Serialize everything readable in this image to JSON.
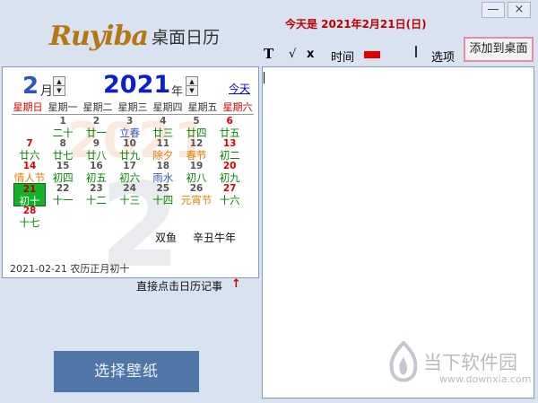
{
  "app": {
    "logo_brand": "Ruyiba",
    "logo_title": "桌面日历",
    "today_header": "今天是 2021年2月21日(日)",
    "min_icon": "minimize-icon",
    "close_icon": "close-icon",
    "min_glyph": "—",
    "close_glyph": "×"
  },
  "toolbar": {
    "bold_label": "T",
    "check_label": "√",
    "x_label": "x",
    "time_label": "时间",
    "color_swatch": "#e00000",
    "options_label": "选项",
    "add_to_desktop_label": "添加到桌面"
  },
  "calendar": {
    "month": "2",
    "month_unit": "月",
    "year": "2021",
    "year_unit": "年",
    "today_link": "今天",
    "watermark_year": "2021",
    "watermark_month": "2",
    "spin_up": "▲",
    "spin_down": "▼",
    "weekdays": [
      "星期日",
      "星期一",
      "星期二",
      "星期三",
      "星期四",
      "星期五",
      "星期六"
    ],
    "days": [
      {
        "d": "1",
        "l": "二十",
        "col": 1,
        "row": 0
      },
      {
        "d": "2",
        "l": "廿一",
        "col": 2,
        "row": 0
      },
      {
        "d": "3",
        "l": "立春",
        "col": 3,
        "row": 0,
        "type": "term"
      },
      {
        "d": "4",
        "l": "廿三",
        "col": 4,
        "row": 0
      },
      {
        "d": "5",
        "l": "廿四",
        "col": 5,
        "row": 0
      },
      {
        "d": "6",
        "l": "廿五",
        "col": 6,
        "row": 0
      },
      {
        "d": "7",
        "l": "廿六",
        "col": 0,
        "row": 1
      },
      {
        "d": "8",
        "l": "廿七",
        "col": 1,
        "row": 1
      },
      {
        "d": "9",
        "l": "廿八",
        "col": 2,
        "row": 1
      },
      {
        "d": "10",
        "l": "廿九",
        "col": 3,
        "row": 1
      },
      {
        "d": "11",
        "l": "除夕",
        "col": 4,
        "row": 1,
        "type": "fest"
      },
      {
        "d": "12",
        "l": "春节",
        "col": 5,
        "row": 1,
        "type": "fest"
      },
      {
        "d": "13",
        "l": "初二",
        "col": 6,
        "row": 1
      },
      {
        "d": "14",
        "l": "情人节",
        "col": 0,
        "row": 2,
        "type": "fest"
      },
      {
        "d": "15",
        "l": "初四",
        "col": 1,
        "row": 2
      },
      {
        "d": "16",
        "l": "初五",
        "col": 2,
        "row": 2
      },
      {
        "d": "17",
        "l": "初六",
        "col": 3,
        "row": 2
      },
      {
        "d": "18",
        "l": "雨水",
        "col": 4,
        "row": 2,
        "type": "term"
      },
      {
        "d": "19",
        "l": "初八",
        "col": 5,
        "row": 2
      },
      {
        "d": "20",
        "l": "初九",
        "col": 6,
        "row": 2
      },
      {
        "d": "21",
        "l": "初十",
        "col": 0,
        "row": 3,
        "type": "sel"
      },
      {
        "d": "22",
        "l": "十一",
        "col": 1,
        "row": 3
      },
      {
        "d": "23",
        "l": "十二",
        "col": 2,
        "row": 3
      },
      {
        "d": "24",
        "l": "十三",
        "col": 3,
        "row": 3
      },
      {
        "d": "25",
        "l": "十四",
        "col": 4,
        "row": 3
      },
      {
        "d": "26",
        "l": "元宵节",
        "col": 5,
        "row": 3,
        "type": "fest"
      },
      {
        "d": "27",
        "l": "十六",
        "col": 6,
        "row": 3
      },
      {
        "d": "28",
        "l": "十七",
        "col": 0,
        "row": 4
      }
    ],
    "zodiac": "双鱼",
    "ganzhi": "辛丑牛年",
    "status": "2021-02-21 农历正月初十"
  },
  "hint": {
    "text": "直接点击日历记事",
    "arrow": "↑"
  },
  "wallpaper_button": "选择壁纸",
  "watermark": {
    "text": "当下软件园",
    "url": "www.downxia.com"
  }
}
